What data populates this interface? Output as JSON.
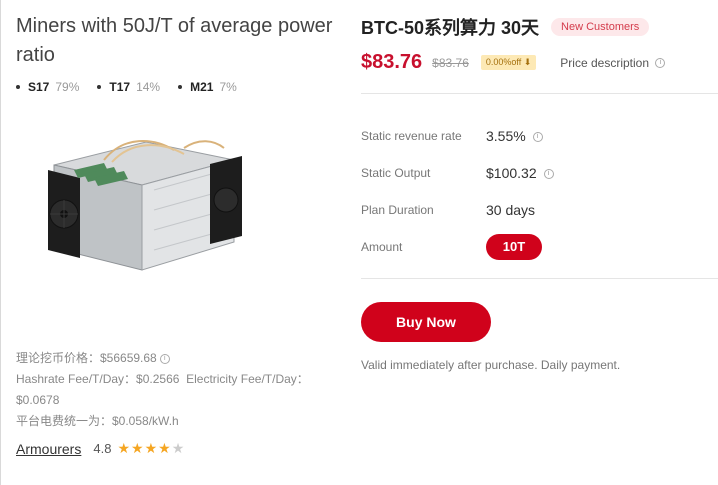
{
  "product": {
    "title": "Miners with 50J/T of average power ratio",
    "mix": [
      {
        "name": "S17",
        "pct": "79%"
      },
      {
        "name": "T17",
        "pct": "14%"
      },
      {
        "name": "M21",
        "pct": "7%"
      }
    ],
    "meta": {
      "theory_price": "理论挖币价格：$56659.68",
      "hashrate_fee": "Hashrate Fee/T/Day：$0.2566",
      "electricity_fee": "Electricity Fee/T/Day：$0.0678",
      "platform_fee": "平台电费统一为：$0.058/kW.h"
    },
    "brand": "Armourers",
    "rating": "4.8",
    "rating_stars": 4
  },
  "plan": {
    "title": "BTC-50系列算力 30天",
    "badge": "New Customers",
    "price": "$83.76",
    "old_price": "$83.76",
    "discount": "0.00%off",
    "price_description": "Price description"
  },
  "specs": {
    "revenue_label": "Static revenue rate",
    "revenue_value": "3.55%",
    "output_label": "Static Output",
    "output_value": "$100.32",
    "duration_label": "Plan Duration",
    "duration_value": "30 days",
    "amount_label": "Amount",
    "amount_value": "10T"
  },
  "actions": {
    "buy_label": "Buy Now",
    "buy_note": "Valid immediately after purchase. Daily payment."
  },
  "colors": {
    "accent": "#d0021b",
    "price": "#c8102e",
    "star": "#f5a623"
  }
}
